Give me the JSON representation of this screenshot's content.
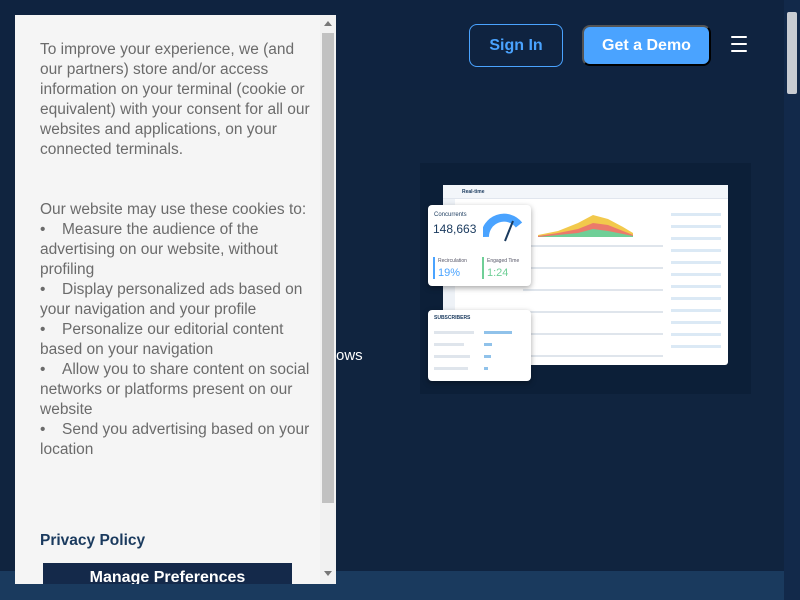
{
  "header": {
    "signin_label": "Sign In",
    "demo_label": "Get a Demo"
  },
  "main": {
    "partial_text": "ows"
  },
  "dashboard": {
    "panel_title": "Real-time",
    "concurrents_label": "Concurrents",
    "concurrents_value": "148,663",
    "recirculation_label": "Recirculation",
    "recirculation_value": "19%",
    "engaged_label": "Engaged Time",
    "engaged_value": "1:24",
    "subscribers_label": "SUBSCRIBERS"
  },
  "cookie": {
    "intro": "To improve your experience, we (and our partners) store and/or access information on your terminal (cookie or equivalent) with your consent for all our websites and applications, on your connected terminals.",
    "list_intro": "Our website may use these cookies to:",
    "items": [
      "Measure the audience of the advertising on our website, without profiling",
      "Display personalized ads based on your navigation and your profile",
      "Personalize our editorial content based on your navigation",
      "Allow you to share content on social networks or platforms present on our website",
      "Send you advertising based on your location"
    ],
    "privacy_label": "Privacy Policy",
    "manage_label": "Manage Preferences"
  },
  "colors": {
    "background": "#0f2340",
    "accent": "#4aa3ff",
    "modal_bg": "#f5f5f5",
    "button_dark": "#14294a"
  }
}
